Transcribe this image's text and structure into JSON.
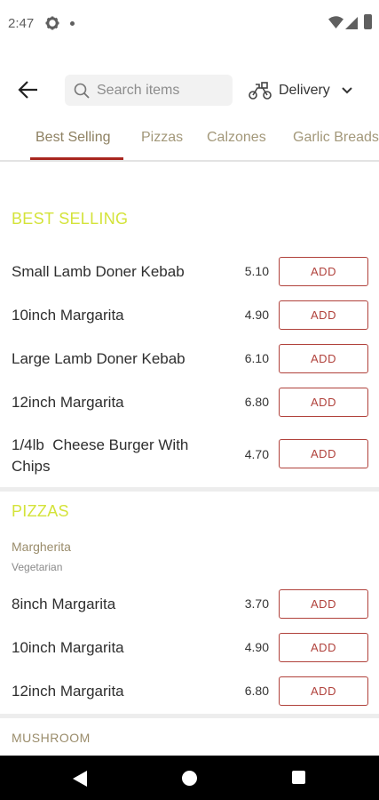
{
  "status_bar": {
    "time": "2:47",
    "icons": [
      "gear-icon",
      "dot-icon",
      "wifi-icon",
      "signal-icon",
      "battery-icon"
    ]
  },
  "header": {
    "back_icon": "arrow-left-icon",
    "search": {
      "placeholder": "Search items",
      "value": "",
      "icon": "search-icon"
    },
    "delivery": {
      "label": "Delivery",
      "icon": "scooter-icon",
      "chevron": "chevron-down-icon"
    }
  },
  "tabs": [
    {
      "label": "Best Selling",
      "active": true
    },
    {
      "label": "Pizzas",
      "active": false
    },
    {
      "label": "Calzones",
      "active": false
    },
    {
      "label": "Garlic Breads",
      "active": false
    }
  ],
  "colors": {
    "accent": "#a8261f",
    "add_button": "#b0413b",
    "section_title": "#d4e33a",
    "tab_text": "#a3987a"
  },
  "sections": {
    "best_selling": {
      "title": "BEST SELLING",
      "items": [
        {
          "name": "Small Lamb Doner Kebab",
          "price": "5.10",
          "button": "ADD"
        },
        {
          "name": "10inch Margarita",
          "price": "4.90",
          "button": "ADD"
        },
        {
          "name": "Large Lamb Doner Kebab",
          "price": "6.10",
          "button": "ADD"
        },
        {
          "name": "12inch Margarita",
          "price": "6.80",
          "button": "ADD"
        },
        {
          "name": "1/4lb  Cheese Burger With Chips",
          "price": "4.70",
          "button": "ADD"
        }
      ]
    },
    "pizzas": {
      "title": "PIZZAS",
      "group": {
        "name": "Margherita",
        "description": "Vegetarian"
      },
      "items": [
        {
          "name": "8inch Margarita",
          "price": "3.70",
          "button": "ADD"
        },
        {
          "name": "10inch Margarita",
          "price": "4.90",
          "button": "ADD"
        },
        {
          "name": "12inch Margarita",
          "price": "6.80",
          "button": "ADD"
        }
      ]
    },
    "mushroom": {
      "title": "MUSHROOM"
    }
  },
  "nav_bar": {
    "icons": [
      "back-triangle-icon",
      "home-circle-icon",
      "recents-square-icon"
    ]
  }
}
